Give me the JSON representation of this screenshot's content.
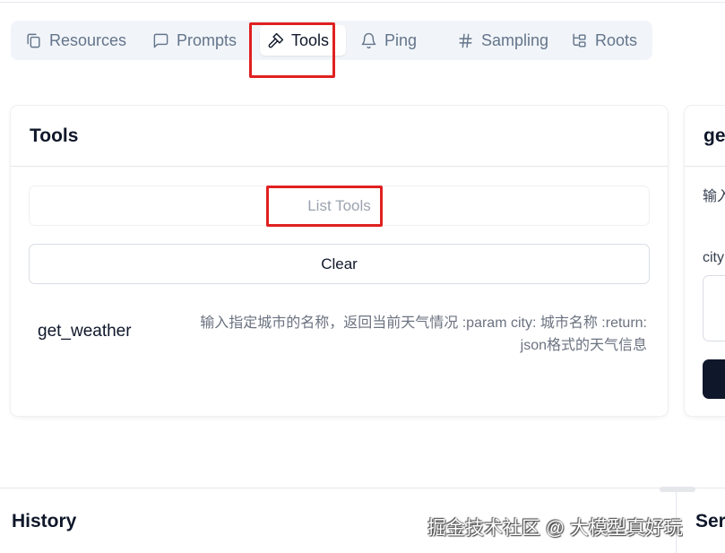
{
  "tabs": [
    {
      "label": "Resources",
      "icon": "files-icon"
    },
    {
      "label": "Prompts",
      "icon": "message-square-icon"
    },
    {
      "label": "Tools",
      "icon": "hammer-icon",
      "active": true
    },
    {
      "label": "Ping",
      "icon": "bell-icon"
    },
    {
      "label": "Sampling",
      "icon": "hash-icon"
    },
    {
      "label": "Roots",
      "icon": "folder-tree-icon"
    }
  ],
  "tools_panel": {
    "title": "Tools",
    "list_button": "List Tools",
    "clear_button": "Clear",
    "tools": [
      {
        "name": "get_weather",
        "description_line1": "输入指定城市的名称，返回当前天气情况 :param city: 城市名称 :return:",
        "description_line2": "json格式的天气信息"
      }
    ]
  },
  "detail_panel": {
    "title": "ge",
    "description": "输入 信息",
    "field_label": "city"
  },
  "bottom": {
    "history_title": "History",
    "server_title": "Ser"
  },
  "watermark": "掘金技术社区 @ 大模型真好玩",
  "colors": {
    "highlight": "#e02020",
    "tab_bg": "#f1f5f9",
    "primary_dark": "#0f172a"
  }
}
